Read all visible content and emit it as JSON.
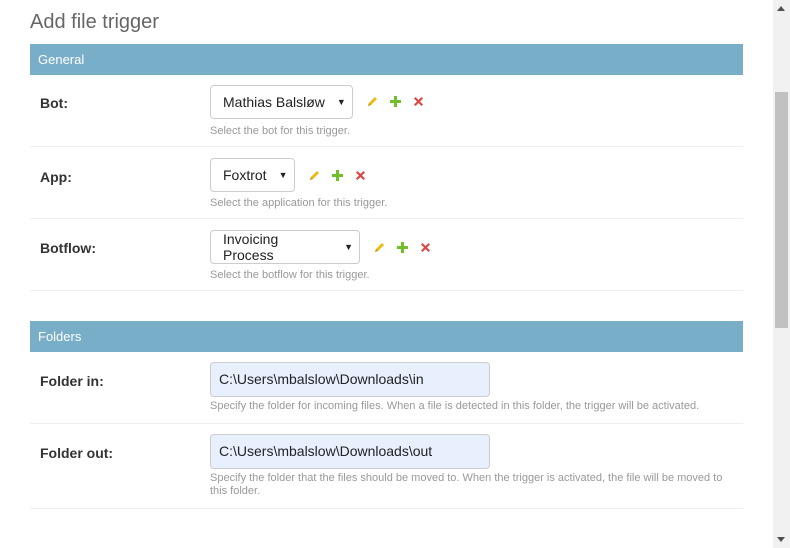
{
  "page": {
    "title": "Add file trigger"
  },
  "general": {
    "header": "General",
    "bot": {
      "label": "Bot:",
      "value": "Mathias Balsløw",
      "help": "Select the bot for this trigger."
    },
    "app": {
      "label": "App:",
      "value": "Foxtrot",
      "help": "Select the application for this trigger."
    },
    "botflow": {
      "label": "Botflow:",
      "value": "Invoicing Process",
      "help": "Select the botflow for this trigger."
    }
  },
  "folders": {
    "header": "Folders",
    "folder_in": {
      "label": "Folder in:",
      "value": "C:\\Users\\mbalslow\\Downloads\\in",
      "help": "Specify the folder for incoming files. When a file is detected in this folder, the trigger will be activated."
    },
    "folder_out": {
      "label": "Folder out:",
      "value": "C:\\Users\\mbalslow\\Downloads\\out",
      "help": "Specify the folder that the files should be moved to. When the trigger is activated, the file will be moved to this folder."
    }
  },
  "icons": {
    "edit": "pencil-icon",
    "add": "plus-icon",
    "delete": "x-icon"
  },
  "colors": {
    "header_bg": "#79aec8",
    "edit": "#efb80b",
    "add": "#70bf2b",
    "delete": "#dd4646",
    "input_autofill": "#e8f0fe"
  }
}
